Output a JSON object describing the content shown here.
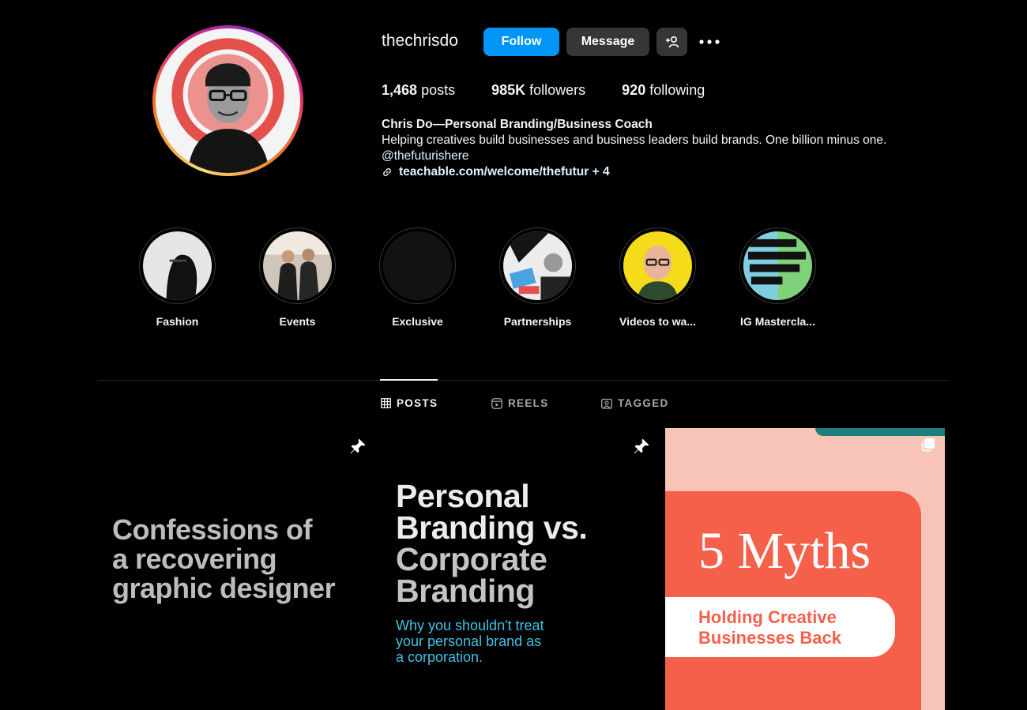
{
  "profile": {
    "username": "thechrisdo",
    "follow_label": "Follow",
    "message_label": "Message",
    "suggest_label": "+",
    "more_label": "•••",
    "stats": {
      "posts_count": "1,468",
      "posts_label": "posts",
      "followers_count": "985K",
      "followers_label": "followers",
      "following_count": "920",
      "following_label": "following"
    },
    "bio": {
      "name": "Chris Do—Personal Branding/Business Coach",
      "text": "Helping creatives build businesses and business leaders build brands. One billion minus one.",
      "mention": "@thefuturishere",
      "link": "teachable.com/welcome/thefutur + 4"
    },
    "colors": {
      "follow_button": "#0095f6",
      "secondary_button": "#363636",
      "link": "#e0f1ff"
    }
  },
  "highlights": [
    {
      "label": "Fashion",
      "icon": "fashion-highlight-thumb"
    },
    {
      "label": "Events",
      "icon": "events-highlight-thumb"
    },
    {
      "label": "Exclusive",
      "icon": "exclusive-highlight-thumb"
    },
    {
      "label": "Partnerships",
      "icon": "partnerships-highlight-thumb"
    },
    {
      "label": "Videos to wa...",
      "icon": "videos-highlight-thumb"
    },
    {
      "label": "IG Mastercla...",
      "icon": "ig-masterclass-highlight-thumb"
    }
  ],
  "tabs": [
    {
      "label": "POSTS",
      "icon": "grid-icon",
      "active": true
    },
    {
      "label": "REELS",
      "icon": "reels-icon",
      "active": false
    },
    {
      "label": "TAGGED",
      "icon": "tagged-icon",
      "active": false
    }
  ],
  "posts": [
    {
      "pinned": true,
      "lines": [
        "Confessions of",
        "a recovering",
        "graphic designer"
      ]
    },
    {
      "pinned": true,
      "title_lines": [
        "Personal",
        "Branding vs.",
        "Corporate",
        "Branding"
      ],
      "subtitle_lines": [
        "Why you shouldn't treat",
        "your personal brand as",
        "a corporation."
      ]
    },
    {
      "pinned": false,
      "title": "5 Myths",
      "pill_lines": [
        "Holding Creative",
        "Businesses Back"
      ]
    }
  ]
}
